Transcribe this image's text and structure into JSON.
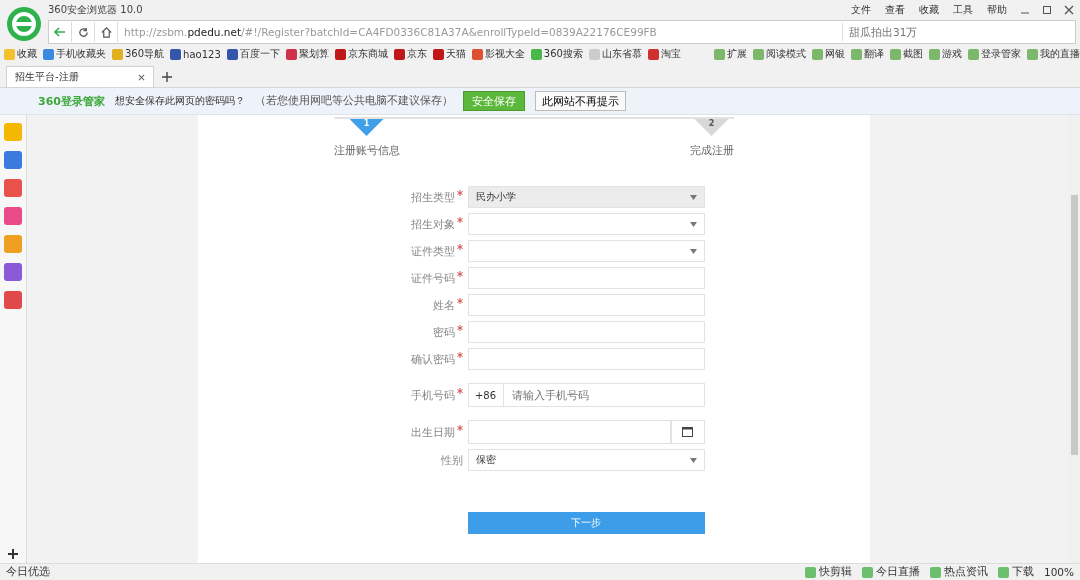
{
  "window": {
    "title": "360安全浏览器 10.0",
    "menu": [
      "文件",
      "查看",
      "收藏",
      "工具",
      "帮助"
    ]
  },
  "address_bar": {
    "url": "http://zsbm.**pdedu.net**/#!/Register?batchId=CA4FD0336C81A37A&enrollTypeId=0839A22176CE99FB",
    "search_placeholder": "甜瓜拍出31万"
  },
  "bookmarks": [
    "收藏",
    "手机收藏夹",
    "360导航",
    "hao123",
    "百度一下",
    "聚划算",
    "京东商城",
    "京东",
    "天猫",
    "影视大全",
    "360搜索",
    "山东省慕",
    "淘宝"
  ],
  "toolbar_right": [
    "扩展",
    "阅读模式",
    "网银",
    "翻译",
    "截图",
    "游戏",
    "登录管家",
    "我的直播"
  ],
  "tabs": [
    {
      "label": "招生平台-注册",
      "selected": true
    }
  ],
  "infobar": {
    "brand": "360登录管家",
    "message": "想安全保存此网页的密码吗？",
    "note": "（若您使用网吧等公共电脑不建议保存）",
    "save_button": "安全保存",
    "dismiss_button": "此网站不再提示"
  },
  "steps": [
    {
      "number": "1",
      "label": "注册账号信息",
      "selected": true
    },
    {
      "number": "2",
      "label": "完成注册",
      "selected": false
    }
  ],
  "form": [
    {
      "label": "招生类型",
      "required": true,
      "kind": "select",
      "value": "民办小学",
      "disabled": true
    },
    {
      "label": "招生对象",
      "required": true,
      "kind": "select",
      "disabled": false
    },
    {
      "label": "证件类型",
      "required": true,
      "kind": "select",
      "disabled": false
    },
    {
      "label": "证件号码",
      "required": true,
      "kind": "text"
    },
    {
      "label": "姓名",
      "required": true,
      "kind": "text"
    },
    {
      "label": "密码",
      "required": true,
      "kind": "text"
    },
    {
      "label": "确认密码",
      "required": true,
      "kind": "text"
    },
    {
      "label": "手机号码",
      "required": true,
      "kind": "phone",
      "prefix": "+86",
      "placeholder": "请输入手机号码"
    },
    {
      "label": "出生日期",
      "required": true,
      "kind": "date"
    },
    {
      "label": "性别",
      "required": false,
      "kind": "select",
      "value": "保密",
      "disabled": false
    }
  ],
  "submit_button": "下一步",
  "status_bar": {
    "left": "今日优选",
    "items": [
      "快剪辑",
      "今日直播",
      "热点资讯",
      "下载"
    ],
    "zoom": "100%"
  }
}
